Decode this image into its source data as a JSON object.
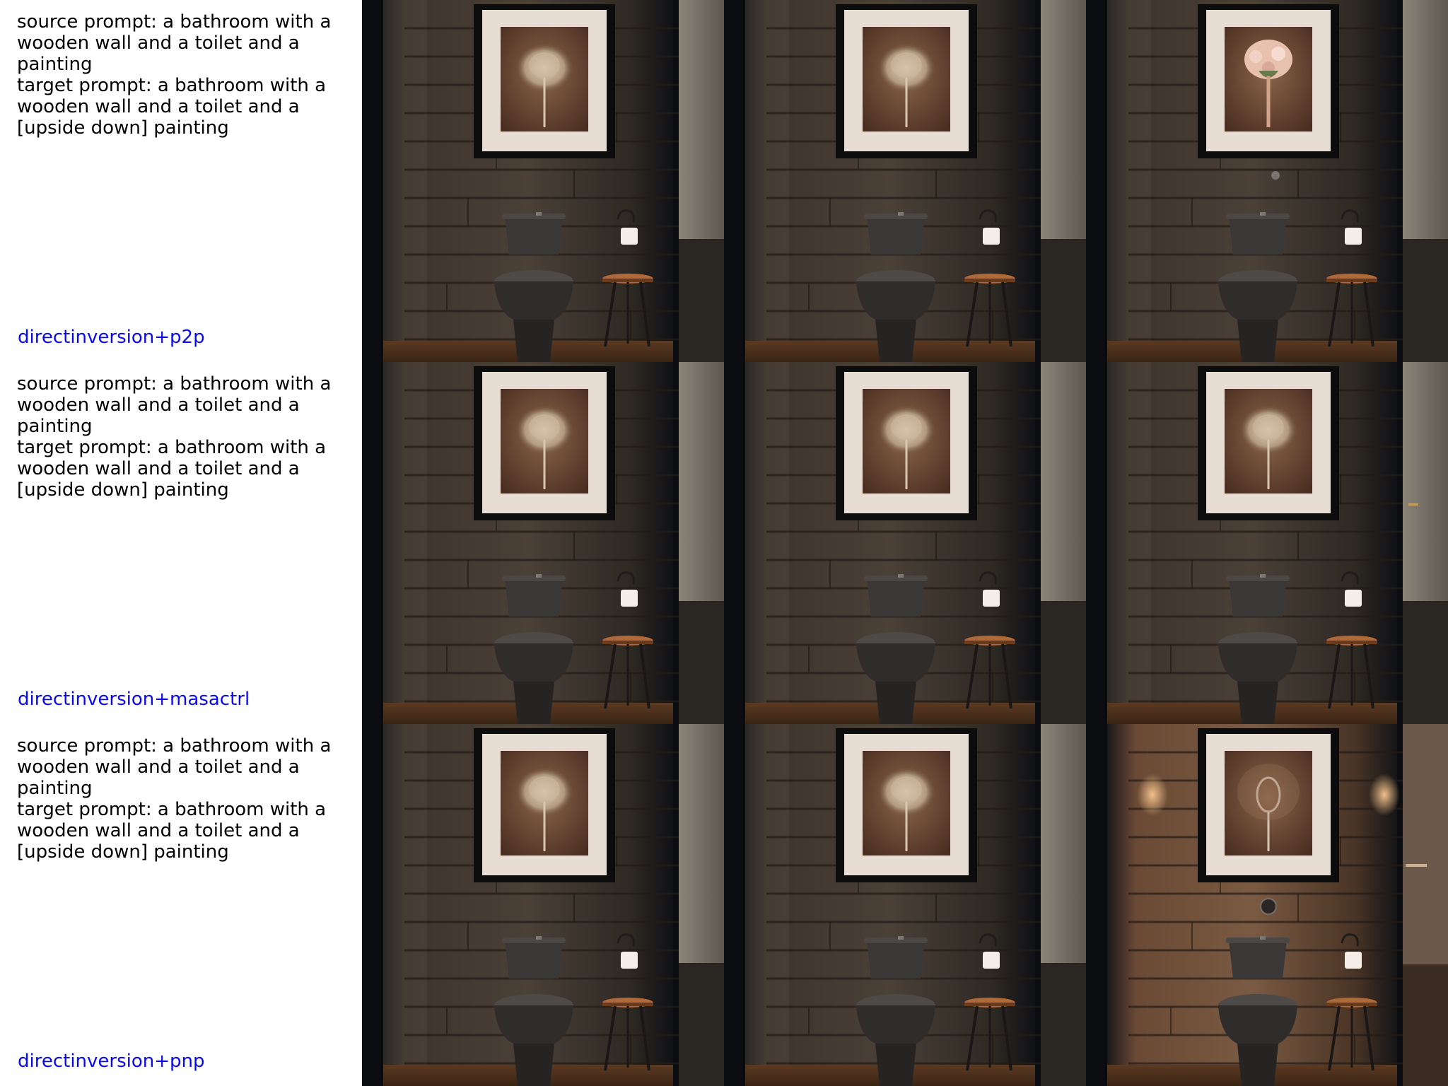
{
  "rows": [
    {
      "source_prompt": "source prompt: a bathroom with a wooden wall and a toilet and a painting",
      "target_prompt": "target prompt: a bathroom with a wooden wall and a toilet and a [upside down] painting",
      "method": "directinversion+p2p"
    },
    {
      "source_prompt": "source prompt: a bathroom with a wooden wall and a toilet and a painting",
      "target_prompt": "target prompt: a bathroom with a wooden wall and a toilet and a [upside down] painting",
      "method": "directinversion+masactrl"
    },
    {
      "source_prompt": "source prompt: a bathroom with a wooden wall and a toilet and a painting",
      "target_prompt": "target prompt: a bathroom with a wooden wall and a toilet and a [upside down] painting",
      "method": "directinversion+pnp"
    }
  ],
  "colors": {
    "label_blue": "#0a0aee",
    "wall_dark": "#3a322b",
    "wall_warm": "#6b4a33",
    "frame": "#111111",
    "mat": "#e6dcd0",
    "painting_bg": "#6e4a36",
    "toilet": "#3b3a38",
    "stool_top": "#b06a3a"
  }
}
